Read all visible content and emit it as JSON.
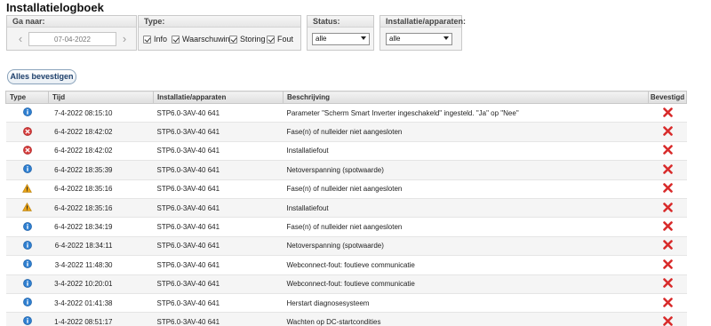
{
  "title": "Installatielogboek",
  "goto": {
    "label": "Ga naar:",
    "date": "07-04-2022",
    "prev_icon": "chevron-left-icon",
    "next_icon": "chevron-right-icon"
  },
  "type_filter": {
    "label": "Type:",
    "options": [
      {
        "label": "Info",
        "checked": true
      },
      {
        "label": "Waarschuwing",
        "checked": true
      },
      {
        "label": "Storing",
        "checked": true
      },
      {
        "label": "Fout",
        "checked": true
      }
    ]
  },
  "status_filter": {
    "label": "Status:",
    "value": "alle"
  },
  "device_filter": {
    "label": "Installatie/apparaten:",
    "value": "alle"
  },
  "confirm_all_label": "Alles bevestigen",
  "columns": [
    "Type",
    "Tijd",
    "Installatie/apparaten",
    "Beschrijving",
    "Bevestigd"
  ],
  "colors": {
    "info": "#2f7fd0",
    "error": "#d43a3a",
    "warning": "#e8a318",
    "unconfirmed": "#d82b2b",
    "header_bg": "#e3e3e3"
  },
  "rows": [
    {
      "type": "info",
      "time": "7-4-2022 08:15:10",
      "device": "STP6.0-3AV-40 641",
      "description": "Parameter \"Scherm Smart Inverter ingeschakeld\" ingesteld. \"Ja\" op \"Nee\"",
      "confirmed_icon": "cross-icon"
    },
    {
      "type": "error",
      "time": "6-4-2022 18:42:02",
      "device": "STP6.0-3AV-40 641",
      "description": "Fase(n) of nulleider niet aangesloten",
      "confirmed_icon": "cross-icon"
    },
    {
      "type": "error",
      "time": "6-4-2022 18:42:02",
      "device": "STP6.0-3AV-40 641",
      "description": "Installatiefout",
      "confirmed_icon": "cross-icon"
    },
    {
      "type": "info",
      "time": "6-4-2022 18:35:39",
      "device": "STP6.0-3AV-40 641",
      "description": "Netoverspanning (spotwaarde)",
      "confirmed_icon": "cross-icon"
    },
    {
      "type": "warning",
      "time": "6-4-2022 18:35:16",
      "device": "STP6.0-3AV-40 641",
      "description": "Fase(n) of nulleider niet aangesloten",
      "confirmed_icon": "cross-icon"
    },
    {
      "type": "warning",
      "time": "6-4-2022 18:35:16",
      "device": "STP6.0-3AV-40 641",
      "description": "Installatiefout",
      "confirmed_icon": "cross-icon"
    },
    {
      "type": "info",
      "time": "6-4-2022 18:34:19",
      "device": "STP6.0-3AV-40 641",
      "description": "Fase(n) of nulleider niet aangesloten",
      "confirmed_icon": "cross-icon"
    },
    {
      "type": "info",
      "time": "6-4-2022 18:34:11",
      "device": "STP6.0-3AV-40 641",
      "description": "Netoverspanning (spotwaarde)",
      "confirmed_icon": "cross-icon"
    },
    {
      "type": "info",
      "time": "3-4-2022 11:48:30",
      "device": "STP6.0-3AV-40 641",
      "description": "Webconnect-fout: foutieve communicatie",
      "confirmed_icon": "cross-icon"
    },
    {
      "type": "info",
      "time": "3-4-2022 10:20:01",
      "device": "STP6.0-3AV-40 641",
      "description": "Webconnect-fout: foutieve communicatie",
      "confirmed_icon": "cross-icon"
    },
    {
      "type": "info",
      "time": "3-4-2022 01:41:38",
      "device": "STP6.0-3AV-40 641",
      "description": "Herstart diagnosesysteem",
      "confirmed_icon": "cross-icon"
    },
    {
      "type": "info",
      "time": "1-4-2022 08:51:17",
      "device": "STP6.0-3AV-40 641",
      "description": "Wachten op DC-startcondities",
      "confirmed_icon": "cross-icon"
    }
  ]
}
